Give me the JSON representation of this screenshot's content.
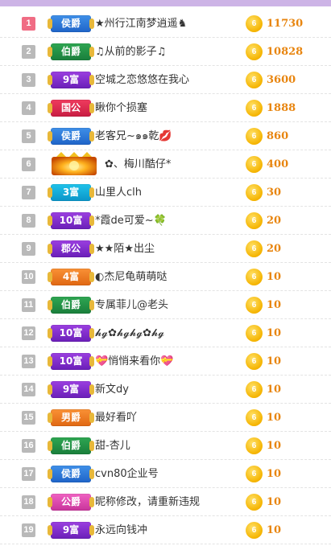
{
  "colors": {
    "top_bar": "#cdb4e6",
    "rank_first": "#f06c84",
    "rank_default": "#b9b9b9",
    "amount": "#e8850f",
    "coin": "#f5b400"
  },
  "coin_icon_glyph": "6",
  "rows": [
    {
      "rank": "1",
      "badge": "侯爵",
      "badge_color": "blue",
      "name": "★州行江南梦逍遥♞",
      "amount": "11730"
    },
    {
      "rank": "2",
      "badge": "伯爵",
      "badge_color": "green",
      "name": "♫从前的影子♫",
      "amount": "10828"
    },
    {
      "rank": "3",
      "badge": "9富",
      "badge_color": "purple",
      "name": "空城之恋悠悠在我心",
      "amount": "3600"
    },
    {
      "rank": "4",
      "badge": "国公",
      "badge_color": "red",
      "name": "瞅你个损塞",
      "amount": "1888"
    },
    {
      "rank": "5",
      "badge": "侯爵",
      "badge_color": "blue",
      "name": "老客兄~๑๑乾💋",
      "amount": "860"
    },
    {
      "rank": "6",
      "badge": "",
      "badge_color": "crown",
      "name": "✿、梅川酷仔*",
      "amount": "400"
    },
    {
      "rank": "7",
      "badge": "3富",
      "badge_color": "cyan",
      "name": "山里人clh",
      "amount": "30"
    },
    {
      "rank": "8",
      "badge": "10富",
      "badge_color": "purple",
      "name": "*霞de可爱~🍀",
      "amount": "20"
    },
    {
      "rank": "9",
      "badge": "郡公",
      "badge_color": "purple",
      "name": "★★陌★出尘",
      "amount": "20"
    },
    {
      "rank": "10",
      "badge": "4富",
      "badge_color": "orange",
      "name": "◐杰尼龟萌萌哒",
      "amount": "10"
    },
    {
      "rank": "11",
      "badge": "伯爵",
      "badge_color": "green",
      "name": "专属菲儿@老头",
      "amount": "10"
    },
    {
      "rank": "12",
      "badge": "10富",
      "badge_color": "purple",
      "name": "𝓱𝓰✿𝓱𝓰𝓱𝓰✿𝓱𝓰",
      "amount": "10"
    },
    {
      "rank": "13",
      "badge": "10富",
      "badge_color": "purple",
      "name": "💝悄悄来看你💝",
      "amount": "10"
    },
    {
      "rank": "14",
      "badge": "9富",
      "badge_color": "purple",
      "name": "新文dy",
      "amount": "10"
    },
    {
      "rank": "15",
      "badge": "男爵",
      "badge_color": "orange",
      "name": "最好看吖",
      "amount": "10"
    },
    {
      "rank": "16",
      "badge": "伯爵",
      "badge_color": "green",
      "name": "甜-杏儿",
      "amount": "10"
    },
    {
      "rank": "17",
      "badge": "侯爵",
      "badge_color": "blue",
      "name": "cvn80企业号",
      "amount": "10"
    },
    {
      "rank": "18",
      "badge": "公爵",
      "badge_color": "pink",
      "name": "昵称修改，请重新违规",
      "amount": "10"
    },
    {
      "rank": "19",
      "badge": "9富",
      "badge_color": "purple",
      "name": "永远向钱冲",
      "amount": "10"
    }
  ]
}
